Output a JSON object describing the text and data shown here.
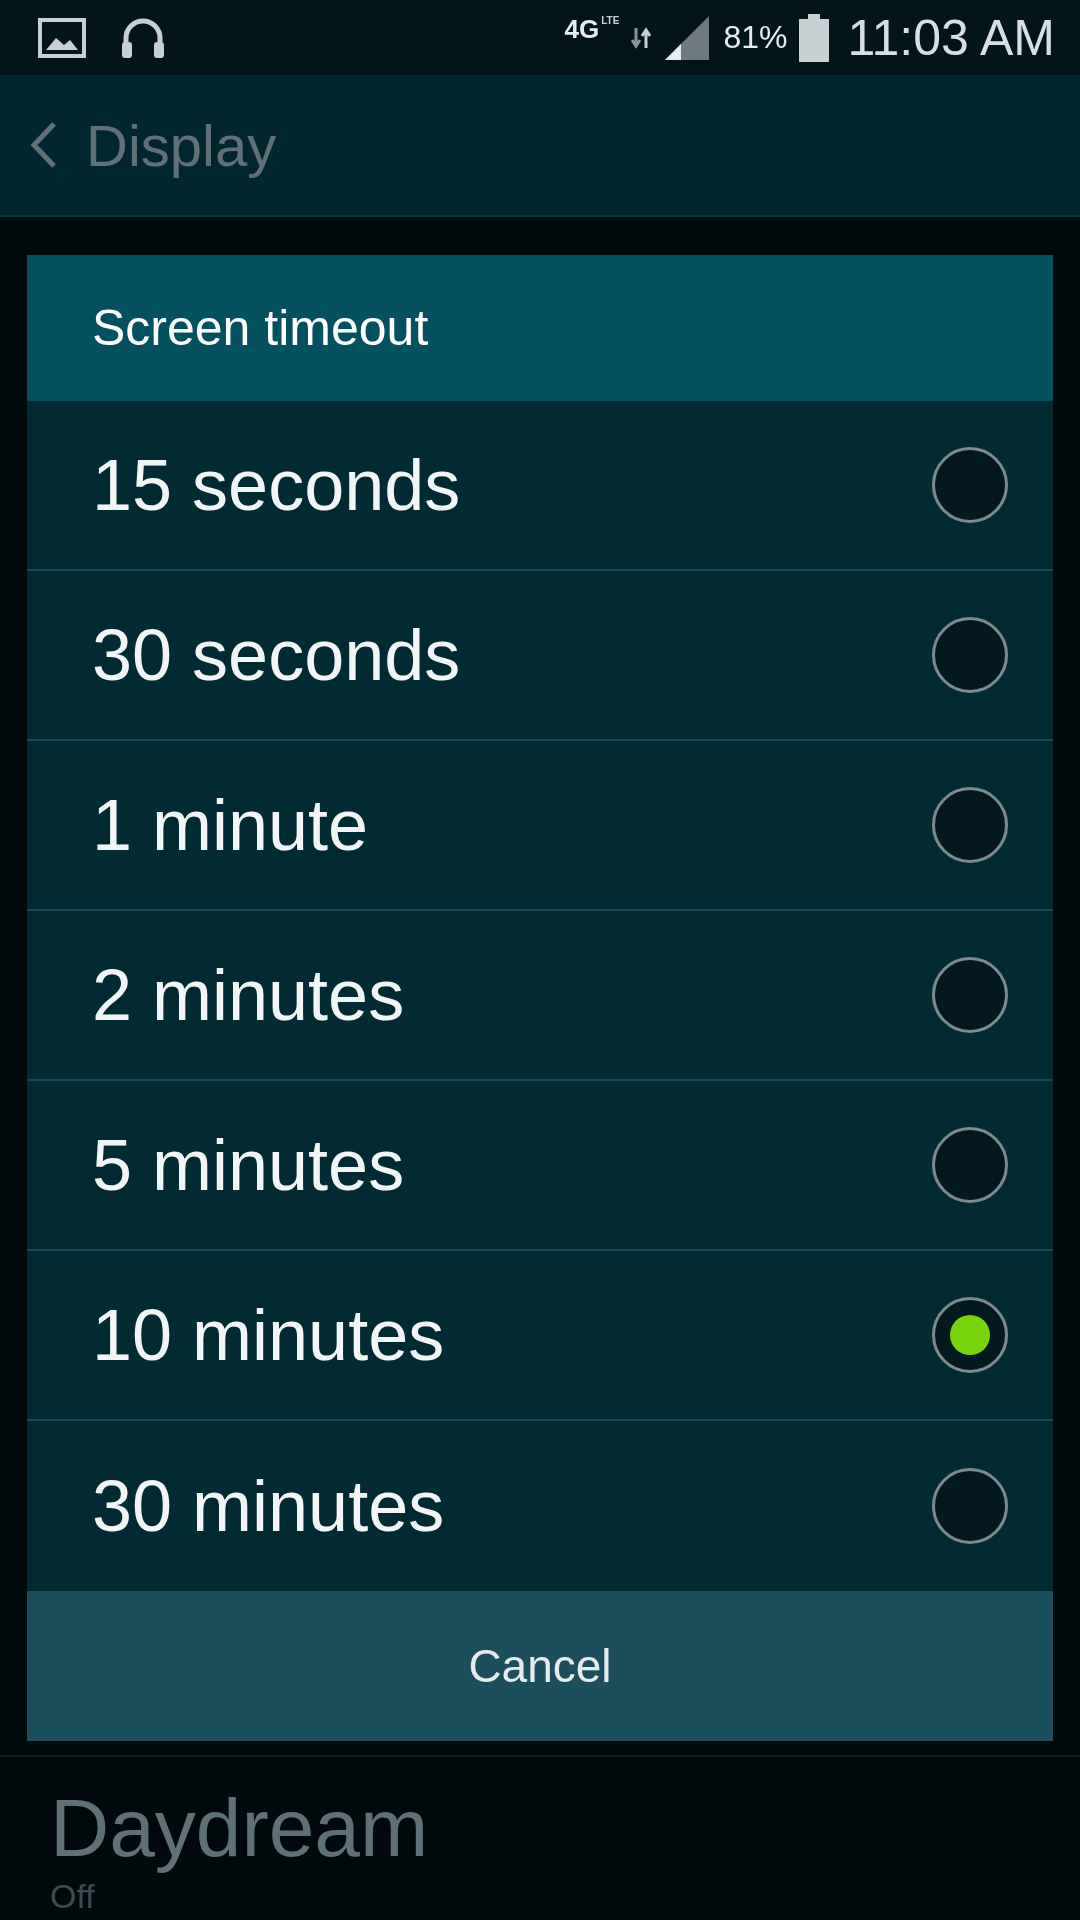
{
  "status_bar": {
    "network": "4G",
    "network_sub": "LTE",
    "battery": "81%",
    "time": "11:03 AM"
  },
  "action_bar": {
    "title": "Display"
  },
  "dialog": {
    "title": "Screen timeout",
    "options": [
      {
        "label": "15 seconds",
        "selected": false
      },
      {
        "label": "30 seconds",
        "selected": false
      },
      {
        "label": "1 minute",
        "selected": false
      },
      {
        "label": "2 minutes",
        "selected": false
      },
      {
        "label": "5 minutes",
        "selected": false
      },
      {
        "label": "10 minutes",
        "selected": true
      },
      {
        "label": "30 minutes",
        "selected": false
      }
    ],
    "cancel": "Cancel"
  },
  "background_item": {
    "title": "Daydream",
    "summary": "Off"
  }
}
